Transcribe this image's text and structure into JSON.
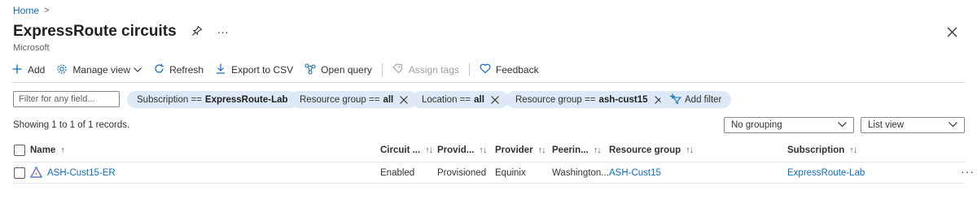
{
  "breadcrumb": {
    "home": "Home",
    "separator": ">"
  },
  "header": {
    "title": "ExpressRoute circuits",
    "subtitle": "Microsoft",
    "pin_icon": "pin-icon",
    "more_icon": "ellipsis-icon",
    "close_icon": "close-icon"
  },
  "toolbar": {
    "add": "Add",
    "manage_view": "Manage view",
    "refresh": "Refresh",
    "export_csv": "Export to CSV",
    "open_query": "Open query",
    "assign_tags": "Assign tags",
    "feedback": "Feedback"
  },
  "filters": {
    "placeholder": "Filter for any field...",
    "pills": [
      {
        "label": "Subscription == ",
        "value": "ExpressRoute-Lab",
        "removable": false
      },
      {
        "label": "Resource group == ",
        "value": "all",
        "removable": true
      },
      {
        "label": "Location == ",
        "value": "all",
        "removable": true
      },
      {
        "label": "Resource group == ",
        "value": "ash-cust15",
        "removable": true
      }
    ],
    "add_filter": "Add filter"
  },
  "records_text": "Showing 1 to 1 of 1 records.",
  "grouping": {
    "selected": "No grouping"
  },
  "view": {
    "selected": "List view"
  },
  "table": {
    "columns": {
      "name": "Name",
      "circuit": "Circuit ...",
      "provider_status": "Provid...",
      "provider": "Provider",
      "peering": "Peerin...",
      "resource_group": "Resource group",
      "subscription": "Subscription"
    },
    "rows": [
      {
        "name": "ASH-Cust15-ER",
        "circuit": "Enabled",
        "provider_status": "Provisioned",
        "provider": "Equinix",
        "peering": "Washington...",
        "resource_group": "ASH-Cust15",
        "subscription": "ExpressRoute-Lab"
      }
    ]
  },
  "colors": {
    "accent": "#0f6cbd",
    "pill_bg": "#dde9f6"
  }
}
